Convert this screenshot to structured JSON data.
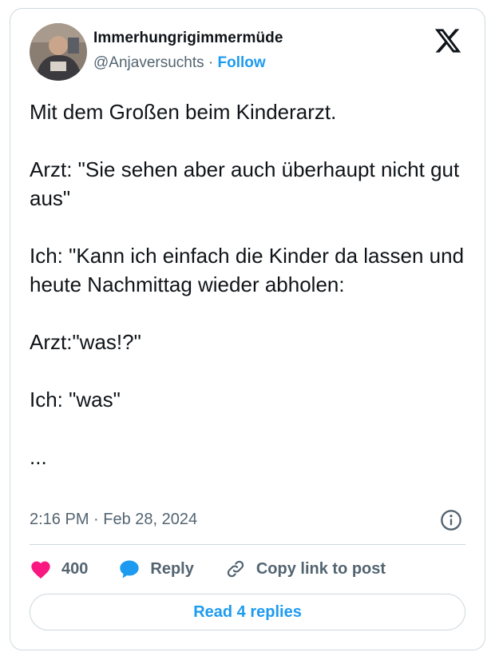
{
  "author": {
    "display_name": "Immerhungrigimmermüde",
    "handle": "@Anjaversuchts",
    "separator": "·",
    "follow_label": "Follow"
  },
  "tweet": {
    "text": "Mit dem Großen beim Kinderarzt.\n\nArzt: \"Sie sehen aber auch überhaupt nicht gut aus\"\n\nIch: \"Kann ich einfach die Kinder da lassen und heute Nachmittag wieder abholen:\n\nArzt:\"was!?\"\n\nIch: \"was\"\n\n...",
    "timestamp": "2:16 PM · Feb 28, 2024"
  },
  "actions": {
    "like_count": "400",
    "reply_label": "Reply",
    "copy_label": "Copy link to post"
  },
  "read_replies_label": "Read 4 replies",
  "icons": {
    "brand": "x-logo-icon",
    "like": "heart-icon",
    "reply": "speech-bubble-icon",
    "copy": "link-icon",
    "info": "info-icon"
  },
  "colors": {
    "accent": "#1d9bf0",
    "like": "#f91880",
    "text": "#0f1419",
    "muted": "#536471",
    "border": "#cfd9de"
  }
}
